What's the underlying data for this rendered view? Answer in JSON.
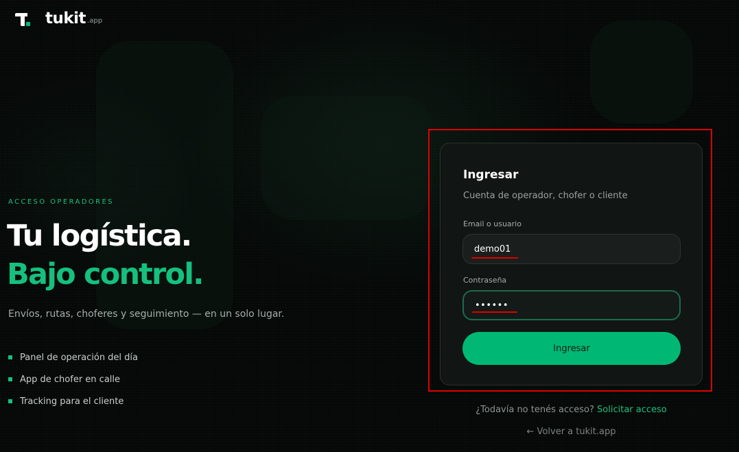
{
  "brand": {
    "name": "tukit",
    "suffix": ".app",
    "accent_color": "#00b873"
  },
  "hero": {
    "eyebrow": "ACCESO OPERADORES",
    "headline_line1": "Tu logística.",
    "headline_line2": "Bajo control.",
    "subtitle": "Envíos, rutas, choferes y seguimiento — en un solo lugar.",
    "features": [
      "Panel de operación del día",
      "App de chofer en calle",
      "Tracking para el cliente"
    ]
  },
  "login": {
    "title": "Ingresar",
    "subtitle": "Cuenta de operador, chofer o cliente",
    "email_label": "Email o usuario",
    "email_value": "demo01",
    "password_label": "Contraseña",
    "password_value": "demo01",
    "submit_label": "Ingresar"
  },
  "footer": {
    "no_access_text": "¿Todavía no tenés acceso?",
    "request_access_link": "Solicitar acceso",
    "back_link": "← Volver a tukit.app"
  },
  "annotation_color": "#e00000"
}
